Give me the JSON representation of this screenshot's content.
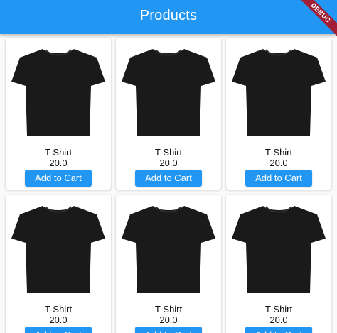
{
  "appbar": {
    "title": "Products",
    "color": "#2196f3"
  },
  "debug_banner": {
    "label": "DEBUG",
    "color": "#a11f36"
  },
  "products": [
    {
      "name": "T-Shirt",
      "price": "20.0",
      "button_label": "Add to Cart",
      "image_icon": "tshirt-icon"
    },
    {
      "name": "T-Shirt",
      "price": "20.0",
      "button_label": "Add to Cart",
      "image_icon": "tshirt-icon"
    },
    {
      "name": "T-Shirt",
      "price": "20.0",
      "button_label": "Add to Cart",
      "image_icon": "tshirt-icon"
    },
    {
      "name": "T-Shirt",
      "price": "20.0",
      "button_label": "Add to Cart",
      "image_icon": "tshirt-icon"
    },
    {
      "name": "T-Shirt",
      "price": "20.0",
      "button_label": "Add to Cart",
      "image_icon": "tshirt-icon"
    },
    {
      "name": "T-Shirt",
      "price": "20.0",
      "button_label": "Add to Cart",
      "image_icon": "tshirt-icon"
    }
  ]
}
